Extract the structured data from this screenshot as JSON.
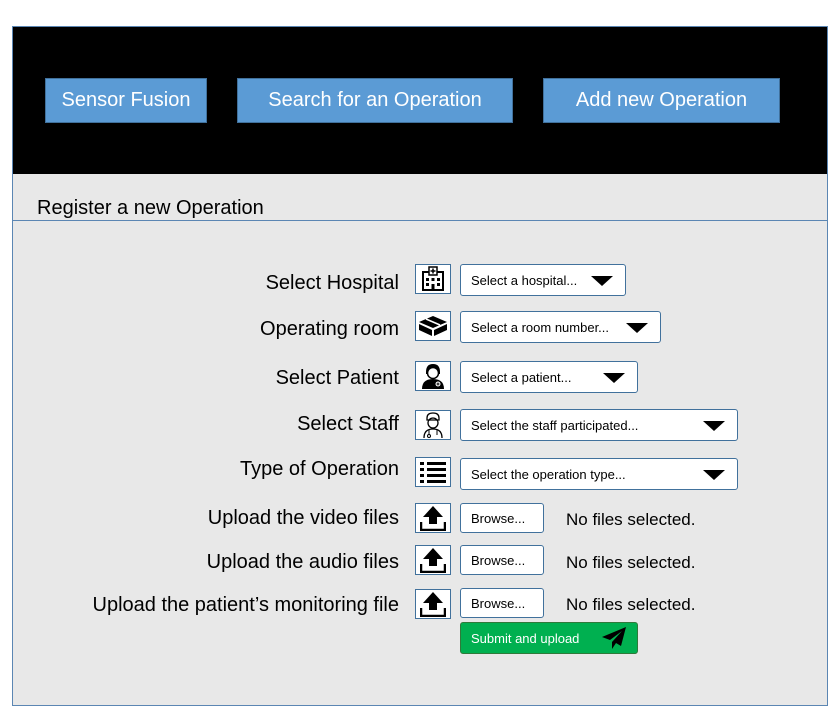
{
  "nav": {
    "buttons": [
      {
        "label": "Sensor Fusion"
      },
      {
        "label": "Search for an Operation"
      },
      {
        "label": "Add new Operation"
      }
    ]
  },
  "form": {
    "title": "Register a new Operation",
    "rows": [
      {
        "label": "Select Hospital",
        "icon": "hospital-icon",
        "placeholder": "Select a hospital..."
      },
      {
        "label": "Operating room",
        "icon": "room-icon",
        "placeholder": "Select a room number..."
      },
      {
        "label": "Select Patient",
        "icon": "patient-icon",
        "placeholder": "Select a patient..."
      },
      {
        "label": "Select Staff",
        "icon": "staff-icon",
        "placeholder": "Select the staff participated..."
      },
      {
        "label": "Type of Operation",
        "icon": "list-icon",
        "placeholder": "Select the operation type..."
      }
    ],
    "uploads": [
      {
        "label": "Upload the video files",
        "icon": "upload-icon",
        "button": "Browse...",
        "status": "No files selected."
      },
      {
        "label": "Upload the audio files",
        "icon": "upload-icon",
        "button": "Browse...",
        "status": "No files selected."
      },
      {
        "label": "Upload the patient’s monitoring file",
        "icon": "upload-icon",
        "button": "Browse...",
        "status": "No files selected."
      }
    ],
    "submit_label": "Submit and upload",
    "submit_icon": "paper-plane-icon"
  },
  "colors": {
    "topbar": "#000000",
    "nav_button": "#5b9bd5",
    "panel": "#e8e8e8",
    "submit": "#00b050",
    "border": "#41719c"
  }
}
